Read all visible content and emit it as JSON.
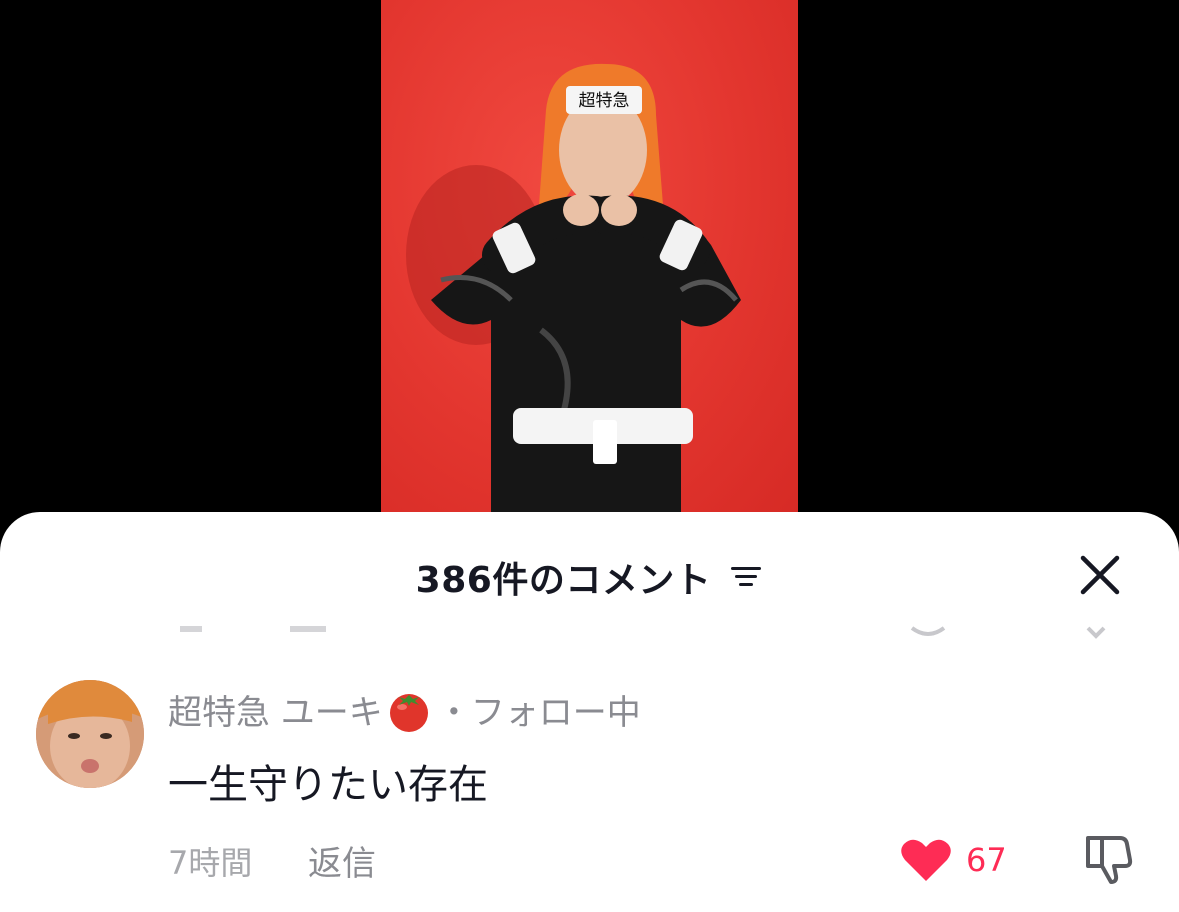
{
  "sheet": {
    "title": "386件のコメント"
  },
  "comment": {
    "author": "超特急 ユーキ",
    "separator": "・",
    "follow_status": "フォロー中",
    "text": "一生守りたい存在",
    "time": "7時間",
    "reply_label": "返信",
    "like_count": "67",
    "liked": true
  },
  "video": {
    "headband_text": "超特急"
  },
  "colors": {
    "like": "#fe2c55",
    "video_background": "#e3362f"
  },
  "icons": [
    "filter-icon",
    "close-icon",
    "tomato-icon",
    "heart-icon",
    "thumbs-down-icon"
  ]
}
